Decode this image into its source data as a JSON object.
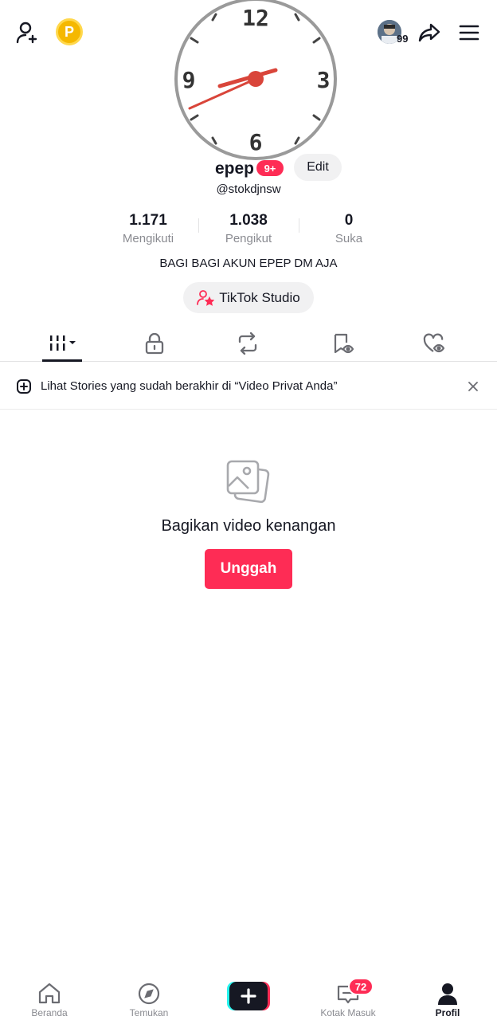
{
  "header": {
    "add_friend_icon": "person-add-icon",
    "coin_icon": "coin-icon",
    "coin_letter": "P",
    "mini_avatar_count": "99",
    "share_icon": "share-arrow-icon",
    "menu_icon": "hamburger-menu-icon"
  },
  "clock": {
    "numerals": [
      "12",
      "3",
      "6",
      "9"
    ],
    "hour_hand_color": "#d9453a",
    "time_hint": "about 8:12"
  },
  "profile": {
    "username": "epep",
    "notification_badge": "9+",
    "edit_label": "Edit",
    "handle": "@stokdjnsw",
    "stats": [
      {
        "value": "1.171",
        "label": "Mengikuti"
      },
      {
        "value": "1.038",
        "label": "Pengikut"
      },
      {
        "value": "0",
        "label": "Suka"
      }
    ],
    "bio": "BAGI BAGI AKUN EPEP DM AJA",
    "studio_label": "TikTok Studio"
  },
  "tabs": [
    {
      "icon": "grid-videos-icon",
      "active": true
    },
    {
      "icon": "lock-icon"
    },
    {
      "icon": "repost-icon"
    },
    {
      "icon": "saved-hidden-icon"
    },
    {
      "icon": "liked-hidden-icon"
    }
  ],
  "banner": {
    "text": "Lihat Stories yang sudah berakhir di “Video Privat Anda”"
  },
  "empty_state": {
    "title": "Bagikan video kenangan",
    "button": "Unggah"
  },
  "bottom_nav": {
    "items": [
      {
        "label": "Beranda",
        "icon": "home-icon"
      },
      {
        "label": "Temukan",
        "icon": "compass-icon"
      },
      {
        "label": "",
        "icon": "create-plus-icon"
      },
      {
        "label": "Kotak Masuk",
        "icon": "inbox-icon"
      },
      {
        "label": "Profil",
        "icon": "profile-icon"
      }
    ],
    "inbox_badge": "72"
  },
  "colors": {
    "accent": "#fe2c55",
    "text": "#161823",
    "muted": "#8a8b91"
  }
}
